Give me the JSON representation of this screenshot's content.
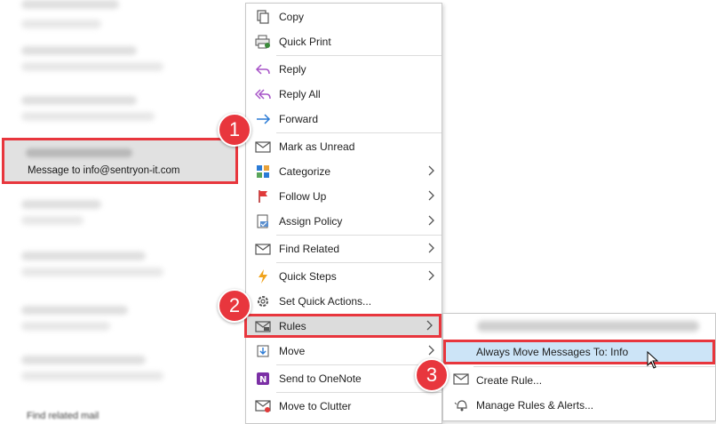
{
  "message_list": {
    "selected_subject": "Message to info@sentryon-it.com",
    "bottom_text": "Find related mail"
  },
  "context_menu": {
    "items": [
      {
        "label": "Copy",
        "icon": "copy-icon"
      },
      {
        "label": "Quick Print",
        "icon": "print-icon"
      },
      {
        "label": "Reply",
        "icon": "reply-icon"
      },
      {
        "label": "Reply All",
        "icon": "reply-all-icon"
      },
      {
        "label": "Forward",
        "icon": "forward-icon"
      },
      {
        "label": "Mark as Unread",
        "icon": "envelope-icon"
      },
      {
        "label": "Categorize",
        "icon": "categorize-icon"
      },
      {
        "label": "Follow Up",
        "icon": "flag-icon"
      },
      {
        "label": "Assign Policy",
        "icon": "policy-icon"
      },
      {
        "label": "Find Related",
        "icon": "find-related-icon"
      },
      {
        "label": "Quick Steps",
        "icon": "lightning-icon"
      },
      {
        "label": "Set Quick Actions...",
        "icon": "gear-icon"
      },
      {
        "label": "Rules",
        "icon": "rules-icon"
      },
      {
        "label": "Move",
        "icon": "move-icon"
      },
      {
        "label": "Send to OneNote",
        "icon": "onenote-icon"
      },
      {
        "label": "Move to Clutter",
        "icon": "clutter-icon"
      }
    ]
  },
  "rules_submenu": {
    "items": [
      {
        "label": "Always Move Messages To: Info"
      },
      {
        "label": "Create Rule..."
      },
      {
        "label": "Manage Rules & Alerts..."
      }
    ]
  },
  "badges": [
    "1",
    "2",
    "3"
  ],
  "colors": {
    "highlight_red": "#e8363d",
    "submenu_hover": "#cce4f7",
    "menu_hover": "#dcdcdc"
  }
}
